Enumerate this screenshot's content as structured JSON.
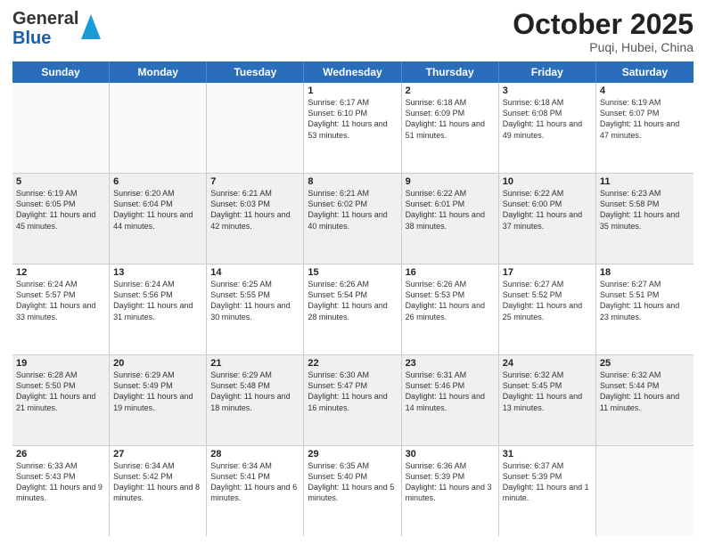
{
  "header": {
    "logo_general": "General",
    "logo_blue": "Blue",
    "month_title": "October 2025",
    "location": "Puqi, Hubei, China"
  },
  "days_of_week": [
    "Sunday",
    "Monday",
    "Tuesday",
    "Wednesday",
    "Thursday",
    "Friday",
    "Saturday"
  ],
  "weeks": [
    [
      {
        "day": "",
        "empty": true
      },
      {
        "day": "",
        "empty": true
      },
      {
        "day": "",
        "empty": true
      },
      {
        "day": "1",
        "sunrise": "6:17 AM",
        "sunset": "6:10 PM",
        "daylight": "11 hours and 53 minutes."
      },
      {
        "day": "2",
        "sunrise": "6:18 AM",
        "sunset": "6:09 PM",
        "daylight": "11 hours and 51 minutes."
      },
      {
        "day": "3",
        "sunrise": "6:18 AM",
        "sunset": "6:08 PM",
        "daylight": "11 hours and 49 minutes."
      },
      {
        "day": "4",
        "sunrise": "6:19 AM",
        "sunset": "6:07 PM",
        "daylight": "11 hours and 47 minutes."
      }
    ],
    [
      {
        "day": "5",
        "sunrise": "6:19 AM",
        "sunset": "6:05 PM",
        "daylight": "11 hours and 45 minutes."
      },
      {
        "day": "6",
        "sunrise": "6:20 AM",
        "sunset": "6:04 PM",
        "daylight": "11 hours and 44 minutes."
      },
      {
        "day": "7",
        "sunrise": "6:21 AM",
        "sunset": "6:03 PM",
        "daylight": "11 hours and 42 minutes."
      },
      {
        "day": "8",
        "sunrise": "6:21 AM",
        "sunset": "6:02 PM",
        "daylight": "11 hours and 40 minutes."
      },
      {
        "day": "9",
        "sunrise": "6:22 AM",
        "sunset": "6:01 PM",
        "daylight": "11 hours and 38 minutes."
      },
      {
        "day": "10",
        "sunrise": "6:22 AM",
        "sunset": "6:00 PM",
        "daylight": "11 hours and 37 minutes."
      },
      {
        "day": "11",
        "sunrise": "6:23 AM",
        "sunset": "5:58 PM",
        "daylight": "11 hours and 35 minutes."
      }
    ],
    [
      {
        "day": "12",
        "sunrise": "6:24 AM",
        "sunset": "5:57 PM",
        "daylight": "11 hours and 33 minutes."
      },
      {
        "day": "13",
        "sunrise": "6:24 AM",
        "sunset": "5:56 PM",
        "daylight": "11 hours and 31 minutes."
      },
      {
        "day": "14",
        "sunrise": "6:25 AM",
        "sunset": "5:55 PM",
        "daylight": "11 hours and 30 minutes."
      },
      {
        "day": "15",
        "sunrise": "6:26 AM",
        "sunset": "5:54 PM",
        "daylight": "11 hours and 28 minutes."
      },
      {
        "day": "16",
        "sunrise": "6:26 AM",
        "sunset": "5:53 PM",
        "daylight": "11 hours and 26 minutes."
      },
      {
        "day": "17",
        "sunrise": "6:27 AM",
        "sunset": "5:52 PM",
        "daylight": "11 hours and 25 minutes."
      },
      {
        "day": "18",
        "sunrise": "6:27 AM",
        "sunset": "5:51 PM",
        "daylight": "11 hours and 23 minutes."
      }
    ],
    [
      {
        "day": "19",
        "sunrise": "6:28 AM",
        "sunset": "5:50 PM",
        "daylight": "11 hours and 21 minutes."
      },
      {
        "day": "20",
        "sunrise": "6:29 AM",
        "sunset": "5:49 PM",
        "daylight": "11 hours and 19 minutes."
      },
      {
        "day": "21",
        "sunrise": "6:29 AM",
        "sunset": "5:48 PM",
        "daylight": "11 hours and 18 minutes."
      },
      {
        "day": "22",
        "sunrise": "6:30 AM",
        "sunset": "5:47 PM",
        "daylight": "11 hours and 16 minutes."
      },
      {
        "day": "23",
        "sunrise": "6:31 AM",
        "sunset": "5:46 PM",
        "daylight": "11 hours and 14 minutes."
      },
      {
        "day": "24",
        "sunrise": "6:32 AM",
        "sunset": "5:45 PM",
        "daylight": "11 hours and 13 minutes."
      },
      {
        "day": "25",
        "sunrise": "6:32 AM",
        "sunset": "5:44 PM",
        "daylight": "11 hours and 11 minutes."
      }
    ],
    [
      {
        "day": "26",
        "sunrise": "6:33 AM",
        "sunset": "5:43 PM",
        "daylight": "11 hours and 9 minutes."
      },
      {
        "day": "27",
        "sunrise": "6:34 AM",
        "sunset": "5:42 PM",
        "daylight": "11 hours and 8 minutes."
      },
      {
        "day": "28",
        "sunrise": "6:34 AM",
        "sunset": "5:41 PM",
        "daylight": "11 hours and 6 minutes."
      },
      {
        "day": "29",
        "sunrise": "6:35 AM",
        "sunset": "5:40 PM",
        "daylight": "11 hours and 5 minutes."
      },
      {
        "day": "30",
        "sunrise": "6:36 AM",
        "sunset": "5:39 PM",
        "daylight": "11 hours and 3 minutes."
      },
      {
        "day": "31",
        "sunrise": "6:37 AM",
        "sunset": "5:39 PM",
        "daylight": "11 hours and 1 minute."
      },
      {
        "day": "",
        "empty": true
      }
    ]
  ]
}
